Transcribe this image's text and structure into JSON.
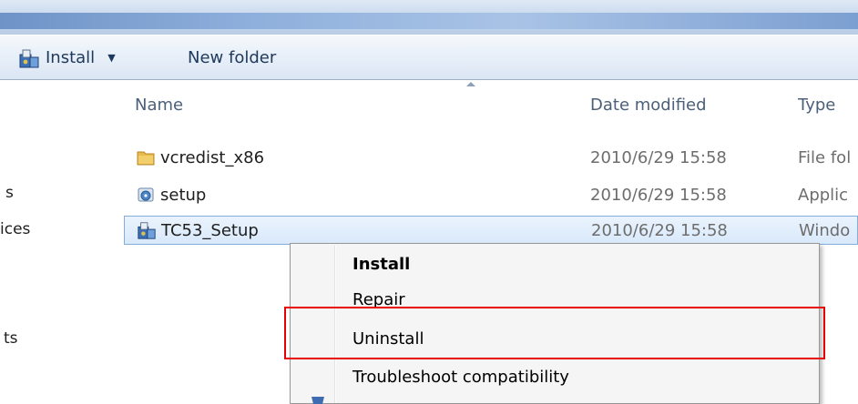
{
  "toolbar": {
    "install_label": "Install",
    "install_caret": "▼",
    "new_folder_label": "New folder"
  },
  "nav": {
    "items": [
      "s",
      "ices",
      "ts"
    ]
  },
  "columns": {
    "name": "Name",
    "date_modified": "Date modified",
    "type": "Type"
  },
  "files": [
    {
      "icon": "folder-icon",
      "name": "vcredist_x86",
      "date": "2010/6/29 15:58",
      "type": "File fol"
    },
    {
      "icon": "setup-app-icon",
      "name": "setup",
      "date": "2010/6/29 15:58",
      "type": "Applic"
    },
    {
      "icon": "installer-icon",
      "name": "TC53_Setup",
      "date": "2010/6/29 15:58",
      "type": "Windo",
      "selected": true
    }
  ],
  "context_menu": {
    "items": [
      {
        "label": "Install",
        "bold": true
      },
      {
        "label": "Repair"
      },
      {
        "label": "Uninstall",
        "highlighted": true
      },
      {
        "label": "Troubleshoot compatibility"
      }
    ]
  },
  "colors": {
    "highlight_box": "#e60000",
    "selection_border": "#84acdd"
  }
}
